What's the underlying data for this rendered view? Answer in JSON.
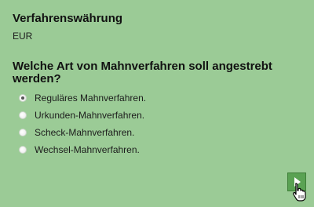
{
  "currency_section": {
    "title": "Verfahrenswährung",
    "value": "EUR"
  },
  "procedure_question": {
    "text": "Welche Art von Mahnverfahren soll angestrebt werden?",
    "options": [
      {
        "label": "Reguläres Mahnverfahren.",
        "selected": true
      },
      {
        "label": "Urkunden-Mahnverfahren.",
        "selected": false
      },
      {
        "label": "Scheck-Mahnverfahren.",
        "selected": false
      },
      {
        "label": "Wechsel-Mahnverfahren.",
        "selected": false
      }
    ]
  },
  "navigation": {
    "next_icon": "play-arrow-icon",
    "cursor_icon": "hand-pointer-icon"
  },
  "colors": {
    "background": "#9bcb96",
    "button": "#5aa253"
  }
}
